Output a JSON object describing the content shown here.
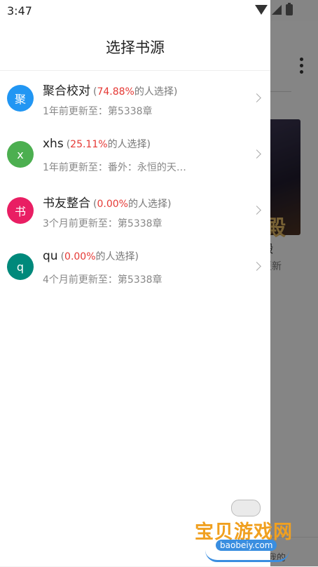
{
  "status_bar": {
    "time": "3:47"
  },
  "drawer": {
    "title": "选择书源",
    "sources": [
      {
        "avatar_char": "聚",
        "avatar_color": "#2196f3",
        "name": "聚合校对",
        "percent": "74.88%",
        "percent_suffix": "的人选择)",
        "update": "1年前更新至：第5338章"
      },
      {
        "avatar_char": "x",
        "avatar_color": "#4caf50",
        "name": "xhs",
        "percent": "25.11%",
        "percent_suffix": "的人选择)",
        "update": "1年前更新至：番外：永恒的天…"
      },
      {
        "avatar_char": "书",
        "avatar_color": "#e91e63",
        "name": "书友整合",
        "percent": "0.00%",
        "percent_suffix": "的人选择)",
        "update": "3个月前更新至：第5338章"
      },
      {
        "avatar_char": "q",
        "avatar_color": "#00897b",
        "name": "qu",
        "percent": "0.00%",
        "percent_suffix": "的人选择)",
        "update": "4个月前更新至：第5338章"
      }
    ]
  },
  "background": {
    "cover_char": "殿",
    "title_fragment": "殿",
    "subtitle_fragment": "更新",
    "tab_fragment": "我的"
  },
  "watermark": {
    "text": "宝贝游戏网",
    "url": "baobeiy.com"
  }
}
